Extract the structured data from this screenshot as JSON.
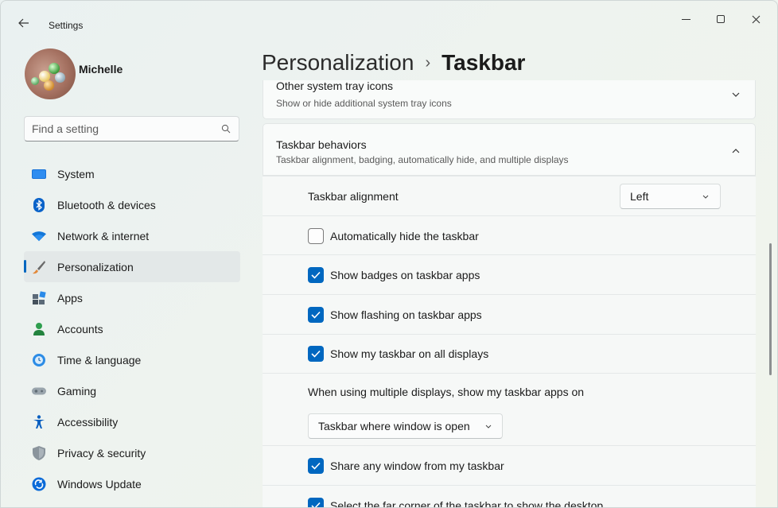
{
  "window": {
    "title": "Settings"
  },
  "user": {
    "name": "Michelle"
  },
  "search": {
    "placeholder": "Find a setting"
  },
  "sidebar": {
    "items": [
      {
        "label": "System",
        "icon": "monitor-icon"
      },
      {
        "label": "Bluetooth & devices",
        "icon": "bluetooth-icon"
      },
      {
        "label": "Network & internet",
        "icon": "wifi-icon"
      },
      {
        "label": "Personalization",
        "icon": "brush-icon",
        "active": true
      },
      {
        "label": "Apps",
        "icon": "apps-icon"
      },
      {
        "label": "Accounts",
        "icon": "person-icon"
      },
      {
        "label": "Time & language",
        "icon": "globe-clock-icon"
      },
      {
        "label": "Gaming",
        "icon": "gamepad-icon"
      },
      {
        "label": "Accessibility",
        "icon": "accessibility-icon"
      },
      {
        "label": "Privacy & security",
        "icon": "shield-icon"
      },
      {
        "label": "Windows Update",
        "icon": "update-icon"
      }
    ]
  },
  "breadcrumb": {
    "parent": "Personalization",
    "separator": "›",
    "current": "Taskbar"
  },
  "sections": {
    "tray": {
      "title": "Other system tray icons",
      "subtitle": "Show or hide additional system tray icons",
      "expanded": false
    },
    "behaviors": {
      "title": "Taskbar behaviors",
      "subtitle": "Taskbar alignment, badging, automatically hide, and multiple displays",
      "expanded": true
    }
  },
  "behaviors": {
    "alignment": {
      "label": "Taskbar alignment",
      "value": "Left"
    },
    "auto_hide": {
      "label": "Automatically hide the taskbar",
      "checked": false
    },
    "badges": {
      "label": "Show badges on taskbar apps",
      "checked": true
    },
    "flashing": {
      "label": "Show flashing on taskbar apps",
      "checked": true
    },
    "all_displays": {
      "label": "Show my taskbar on all displays",
      "checked": true
    },
    "multi_display": {
      "label": "When using multiple displays, show my taskbar apps on",
      "value": "Taskbar where window is open"
    },
    "share_window": {
      "label": "Share any window from my taskbar",
      "checked": true
    },
    "far_corner": {
      "label": "Select the far corner of the taskbar to show the desktop",
      "checked": true
    }
  },
  "colors": {
    "accent": "#0067c0",
    "background": "#edf2ef"
  }
}
